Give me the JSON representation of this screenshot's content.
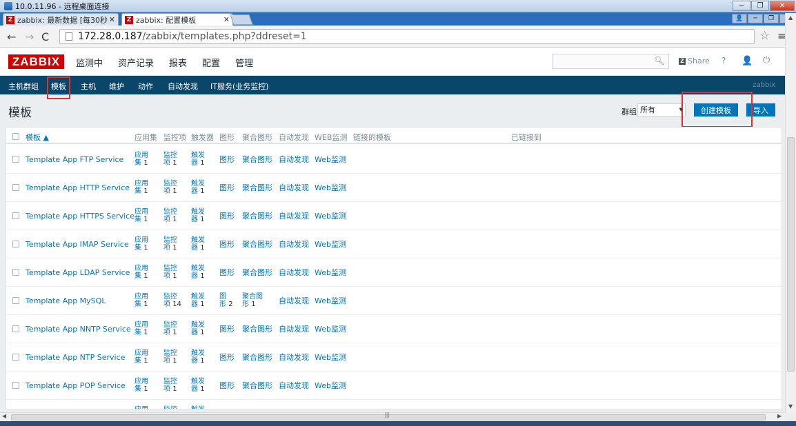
{
  "rdp": {
    "title": "10.0.11.96 - 远程桌面连接"
  },
  "browser": {
    "tabs": [
      {
        "label": "zabbix: 最新数据 [每30秒"
      },
      {
        "label": "zabbix: 配置模板"
      }
    ],
    "url_host": "172.28.0.187",
    "url_path": "/zabbix/templates.php?ddreset=1"
  },
  "header": {
    "logo": "ZABBIX",
    "menu": [
      "监测中",
      "资产记录",
      "报表",
      "配置",
      "管理"
    ],
    "share": "Share",
    "help": "?"
  },
  "subnav": {
    "items": [
      "主机群组",
      "模板",
      "主机",
      "维护",
      "动作",
      "自动发现",
      "IT服务(业务监控)"
    ],
    "brand": "zabbix"
  },
  "page": {
    "title": "模板",
    "group_label": "群组",
    "group_value": "所有",
    "create_button": "创建模板",
    "import_button": "导入"
  },
  "table": {
    "headers": {
      "name": "模板 ▲",
      "apps": "应用集",
      "items": "监控项",
      "triggers": "触发器",
      "graphs": "图形",
      "screens": "聚合图形",
      "discovery": "自动发现",
      "web": "WEB监测",
      "linked_templates": "链接的模板",
      "linked_to": "已链接到"
    },
    "labels": {
      "apps_a": "应用",
      "apps_b": "集",
      "items_a": "监控",
      "items_b": "项",
      "triggers_a": "触发",
      "triggers_b": "器",
      "graphs": "图形",
      "graphs_a": "图",
      "graphs_b": "形",
      "screens": "聚合图形",
      "screens_a": "聚合图",
      "screens_b": "形",
      "discovery": "自动发现",
      "web": "Web监测"
    },
    "rows": [
      {
        "name": "Template App FTP Service",
        "apps": "1",
        "items": "1",
        "triggers": "1"
      },
      {
        "name": "Template App HTTP Service",
        "apps": "1",
        "items": "1",
        "triggers": "1"
      },
      {
        "name": "Template App HTTPS Service",
        "apps": "1",
        "items": "1",
        "triggers": "1"
      },
      {
        "name": "Template App IMAP Service",
        "apps": "1",
        "items": "1",
        "triggers": "1"
      },
      {
        "name": "Template App LDAP Service",
        "apps": "1",
        "items": "1",
        "triggers": "1"
      },
      {
        "name": "Template App MySQL",
        "apps": "1",
        "items": "14",
        "triggers": "1",
        "graphs": "2",
        "screens": "1"
      },
      {
        "name": "Template App NNTP Service",
        "apps": "1",
        "items": "1",
        "triggers": "1"
      },
      {
        "name": "Template App NTP Service",
        "apps": "1",
        "items": "1",
        "triggers": "1"
      },
      {
        "name": "Template App POP Service",
        "apps": "1",
        "items": "1",
        "triggers": "1"
      }
    ]
  },
  "colors": {
    "brand_red": "#d40000",
    "nav_dark": "#0a466a",
    "link_blue": "#0275b8",
    "highlight": "#e03030"
  }
}
